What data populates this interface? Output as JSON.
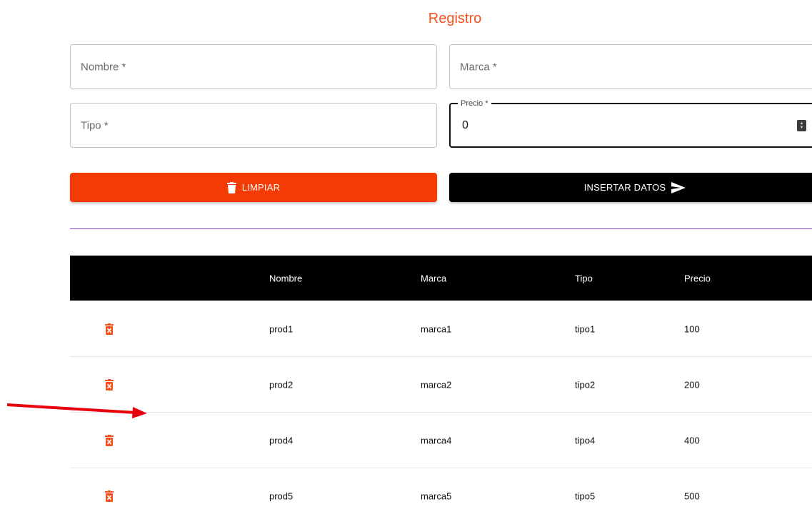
{
  "form": {
    "title": "Registro",
    "nombre_placeholder": "Nombre *",
    "marca_placeholder": "Marca *",
    "tipo_placeholder": "Tipo *",
    "precio_label": "Precio *",
    "precio_value": "0"
  },
  "buttons": {
    "clear_label": "LIMPIAR",
    "insert_label": "INSERTAR DATOS"
  },
  "table": {
    "headers": [
      "Nombre",
      "Marca",
      "Tipo",
      "Precio"
    ],
    "rows": [
      {
        "nombre": "prod1",
        "marca": "marca1",
        "tipo": "tipo1",
        "precio": "100"
      },
      {
        "nombre": "prod2",
        "marca": "marca2",
        "tipo": "tipo2",
        "precio": "200"
      },
      {
        "nombre": "prod4",
        "marca": "marca4",
        "tipo": "tipo4",
        "precio": "400"
      },
      {
        "nombre": "prod5",
        "marca": "marca5",
        "tipo": "tipo5",
        "precio": "500"
      }
    ]
  },
  "icons": {
    "clear": "trash-icon",
    "insert": "send-icon",
    "row_delete": "delete-forever-icon",
    "annotation": "red-arrow-annotation"
  },
  "colors": {
    "accent": "#f4511e",
    "clear_button": "#f43a05",
    "insert_button": "#000000",
    "divider": "#7a4ec2",
    "annotation_arrow": "#e8000b"
  }
}
